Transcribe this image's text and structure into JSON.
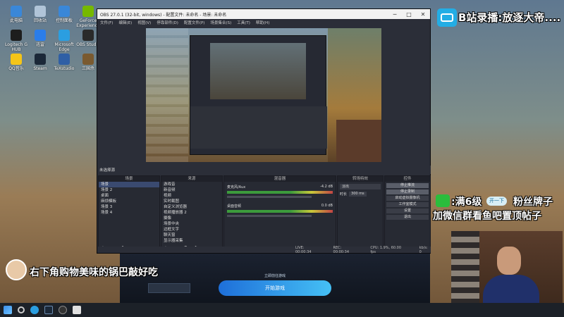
{
  "desktop_icons": [
    {
      "label": "此电脑",
      "color": "#3a87d8"
    },
    {
      "label": "回收站",
      "color": "#b0c4d8"
    },
    {
      "label": "控制面板",
      "color": "#3a87d8"
    },
    {
      "label": "GeForce Experience",
      "color": "#76b900"
    },
    {
      "label": "Logitech G HUB",
      "color": "#1d1d1d"
    },
    {
      "label": "迅雷",
      "color": "#2b7de9"
    },
    {
      "label": "Microsoft Edge",
      "color": "#2b9ee0"
    },
    {
      "label": "OBS Studio",
      "color": "#2a2a2a"
    },
    {
      "label": "QQ音乐",
      "color": "#f5c518"
    },
    {
      "label": "Steam",
      "color": "#1b2838"
    },
    {
      "label": "TeXstudio",
      "color": "#2f5fa5"
    },
    {
      "label": "三国杀",
      "color": "#7a5a30"
    }
  ],
  "obs": {
    "title": "OBS 27.0.1 (32-bit, windows) - 配置文件: 未命名 - 场景: 未命名",
    "menu": [
      "文件(F)",
      "编辑(E)",
      "视图(V)",
      "停靠部件(D)",
      "配置文件(P)",
      "场景集合(S)",
      "工具(T)",
      "帮助(H)"
    ],
    "scene_bar": "未选择源",
    "docks": {
      "scenes": {
        "title": "场景",
        "items": [
          "场景",
          "场景 2",
          "桌面",
          "麻烦模板",
          "场景 3",
          "场景 4"
        ]
      },
      "sources": {
        "title": "来源",
        "items": [
          "游戏音",
          "新音频",
          "视频",
          "实时截图",
          "自定义浏览器",
          "视频播放器 2",
          "摄像",
          "场景中央",
          "边框文字",
          "聊天窗",
          "显示器采集"
        ]
      },
      "mixer": {
        "title": "混音器",
        "tracks": [
          "麦克风/Aux",
          "桌面音频"
        ],
        "levels": [
          "-4.2 dB",
          "0.0 dB"
        ]
      },
      "transitions": {
        "title": "转场特效",
        "type": "淡出",
        "duration_label": "时长",
        "duration": "300 ms"
      },
      "controls": {
        "title": "控件",
        "buttons": [
          "停止推流",
          "停止录制",
          "启动虚拟摄像机",
          "工作室模式",
          "设置",
          "退出"
        ]
      }
    },
    "status": {
      "live": "LIVE: 00:00:34",
      "rec": "REC: 00:00:34",
      "cpu": "CPU: 1.9%, 60.00 fps",
      "kbps": "kb/s: 0"
    }
  },
  "game_panel": {
    "start_button": "开始游戏",
    "hint": "立即前往游戏"
  },
  "overlays": {
    "room_title": "B站录播:放逐大帝....",
    "fans_line1": ":满6级",
    "fans_badge": "开一下",
    "fans_line2": "粉丝牌子",
    "fans_line3": "加微信群看鱼吧置顶帖子",
    "caption": "右下角购物美味的锅巴敲好吃"
  },
  "taskbar": {
    "icons": [
      "windows-start",
      "search",
      "edge",
      "steam",
      "obs",
      "browser"
    ]
  },
  "colors": {
    "accent": "#45c0f5",
    "bilibili": "#23ade5",
    "wechat": "#2bbd3c"
  }
}
